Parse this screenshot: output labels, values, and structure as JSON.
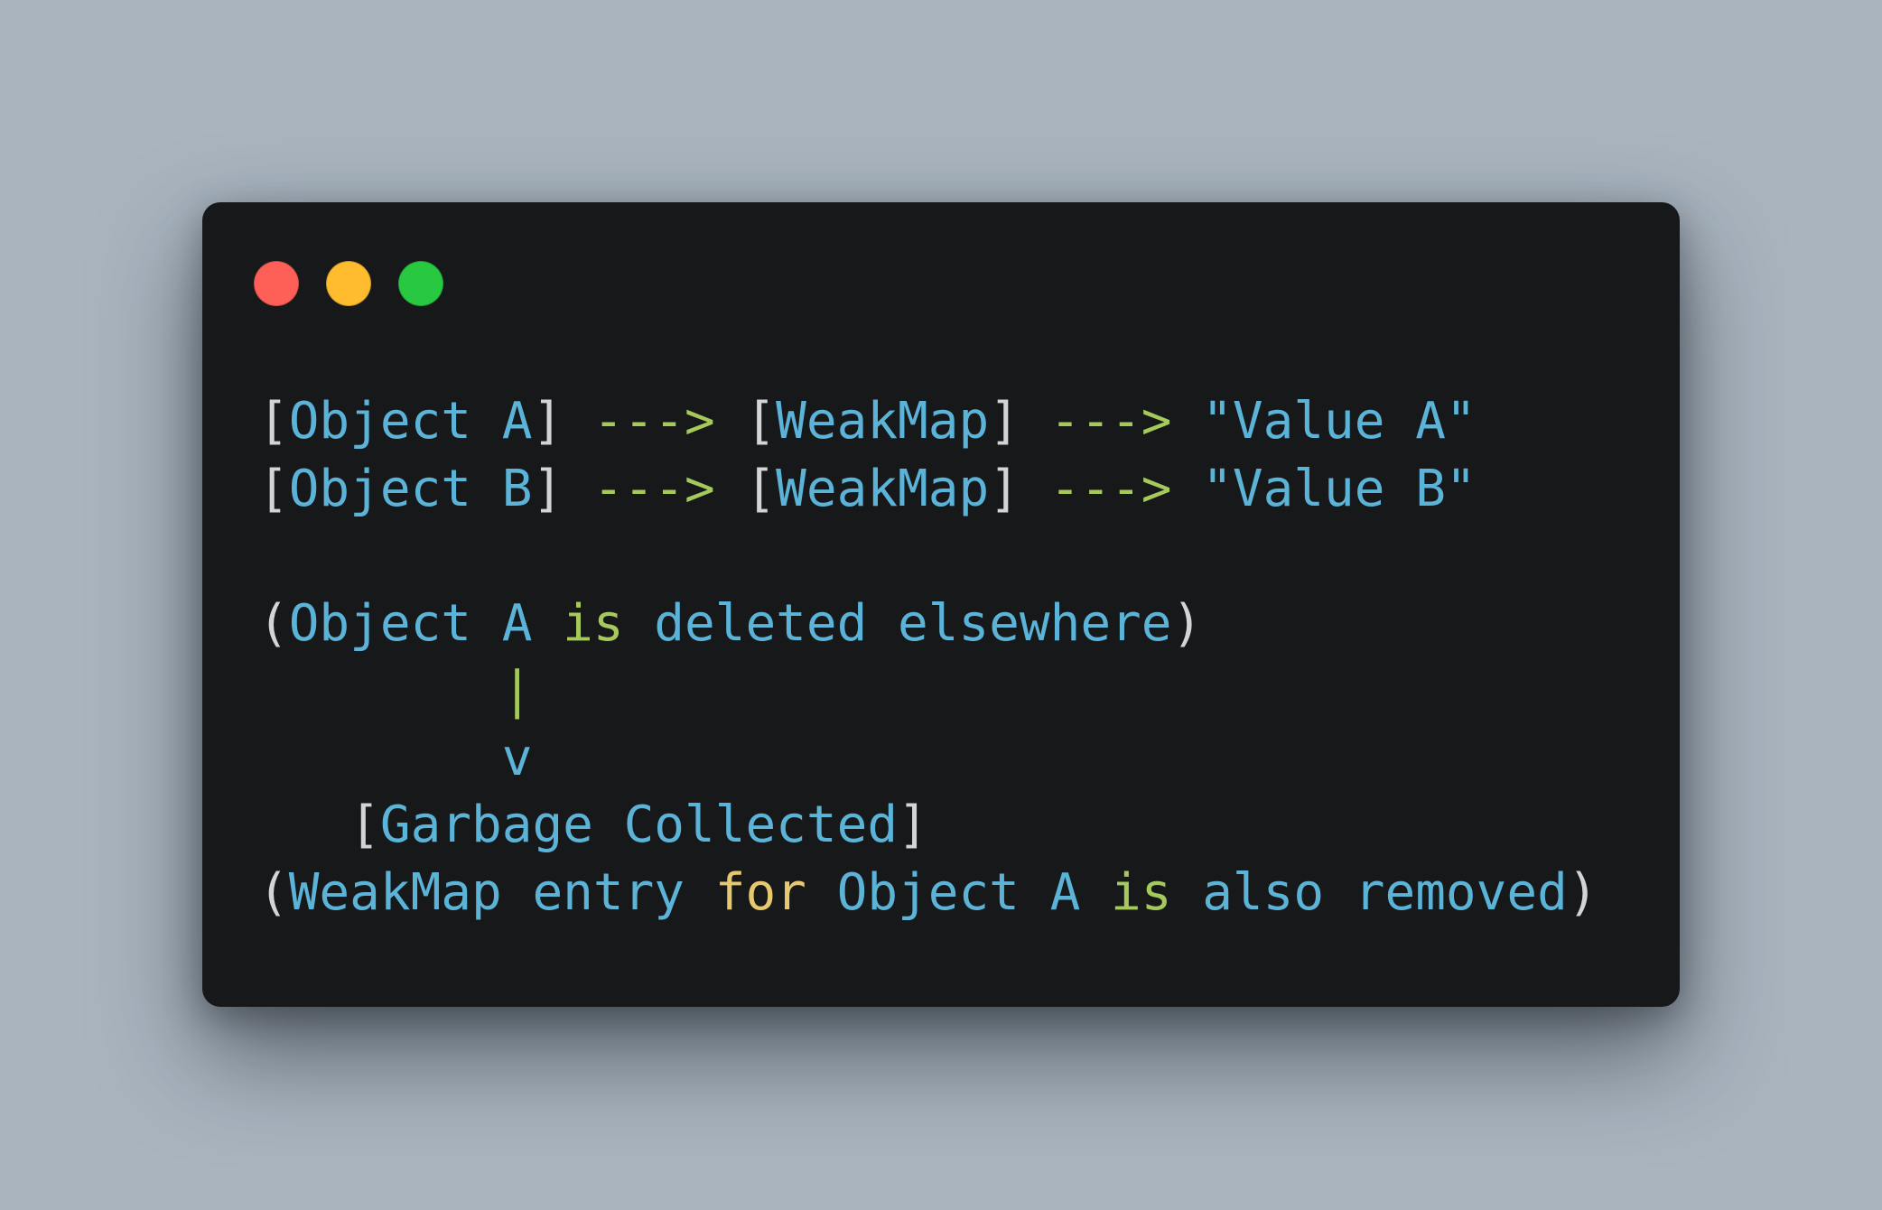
{
  "colors": {
    "background": "#a9b4bf",
    "window": "#17181a",
    "close": "#fe5f57",
    "minimize": "#febc2e",
    "maximize": "#28c840",
    "identifier": "#5bb3d8",
    "punctuation": "#d4d4d4",
    "operator": "#a5c95a",
    "keyword": "#e5c86f"
  },
  "window_controls": [
    {
      "name": "close",
      "icon": "red-dot"
    },
    {
      "name": "minimize",
      "icon": "yellow-dot"
    },
    {
      "name": "maximize",
      "icon": "green-dot"
    }
  ],
  "code_lines": [
    [
      {
        "text": "[",
        "role": "punctuation"
      },
      {
        "text": "Object A",
        "role": "identifier"
      },
      {
        "text": "] ",
        "role": "punctuation"
      },
      {
        "text": "--->",
        "role": "operator"
      },
      {
        "text": " [",
        "role": "punctuation"
      },
      {
        "text": "WeakMap",
        "role": "identifier"
      },
      {
        "text": "] ",
        "role": "punctuation"
      },
      {
        "text": "--->",
        "role": "operator"
      },
      {
        "text": " \"Value A\"",
        "role": "identifier"
      }
    ],
    [
      {
        "text": "[",
        "role": "punctuation"
      },
      {
        "text": "Object B",
        "role": "identifier"
      },
      {
        "text": "] ",
        "role": "punctuation"
      },
      {
        "text": "--->",
        "role": "operator"
      },
      {
        "text": " [",
        "role": "punctuation"
      },
      {
        "text": "WeakMap",
        "role": "identifier"
      },
      {
        "text": "] ",
        "role": "punctuation"
      },
      {
        "text": "--->",
        "role": "operator"
      },
      {
        "text": " \"Value B\"",
        "role": "identifier"
      }
    ],
    [],
    [
      {
        "text": "(",
        "role": "punctuation"
      },
      {
        "text": "Object A ",
        "role": "identifier"
      },
      {
        "text": "is",
        "role": "operator"
      },
      {
        "text": " deleted elsewhere",
        "role": "identifier"
      },
      {
        "text": ")",
        "role": "punctuation"
      }
    ],
    [
      {
        "text": "        ",
        "role": "identifier"
      },
      {
        "text": "|",
        "role": "operator"
      }
    ],
    [
      {
        "text": "        v",
        "role": "identifier"
      }
    ],
    [
      {
        "text": "   ",
        "role": "identifier"
      },
      {
        "text": "[",
        "role": "punctuation"
      },
      {
        "text": "Garbage Collected",
        "role": "identifier"
      },
      {
        "text": "]",
        "role": "punctuation"
      }
    ],
    [
      {
        "text": "(",
        "role": "punctuation"
      },
      {
        "text": "WeakMap entry ",
        "role": "identifier"
      },
      {
        "text": "for",
        "role": "keyword"
      },
      {
        "text": " Object A ",
        "role": "identifier"
      },
      {
        "text": "is",
        "role": "operator"
      },
      {
        "text": " also removed",
        "role": "identifier"
      },
      {
        "text": ")",
        "role": "punctuation"
      }
    ]
  ]
}
